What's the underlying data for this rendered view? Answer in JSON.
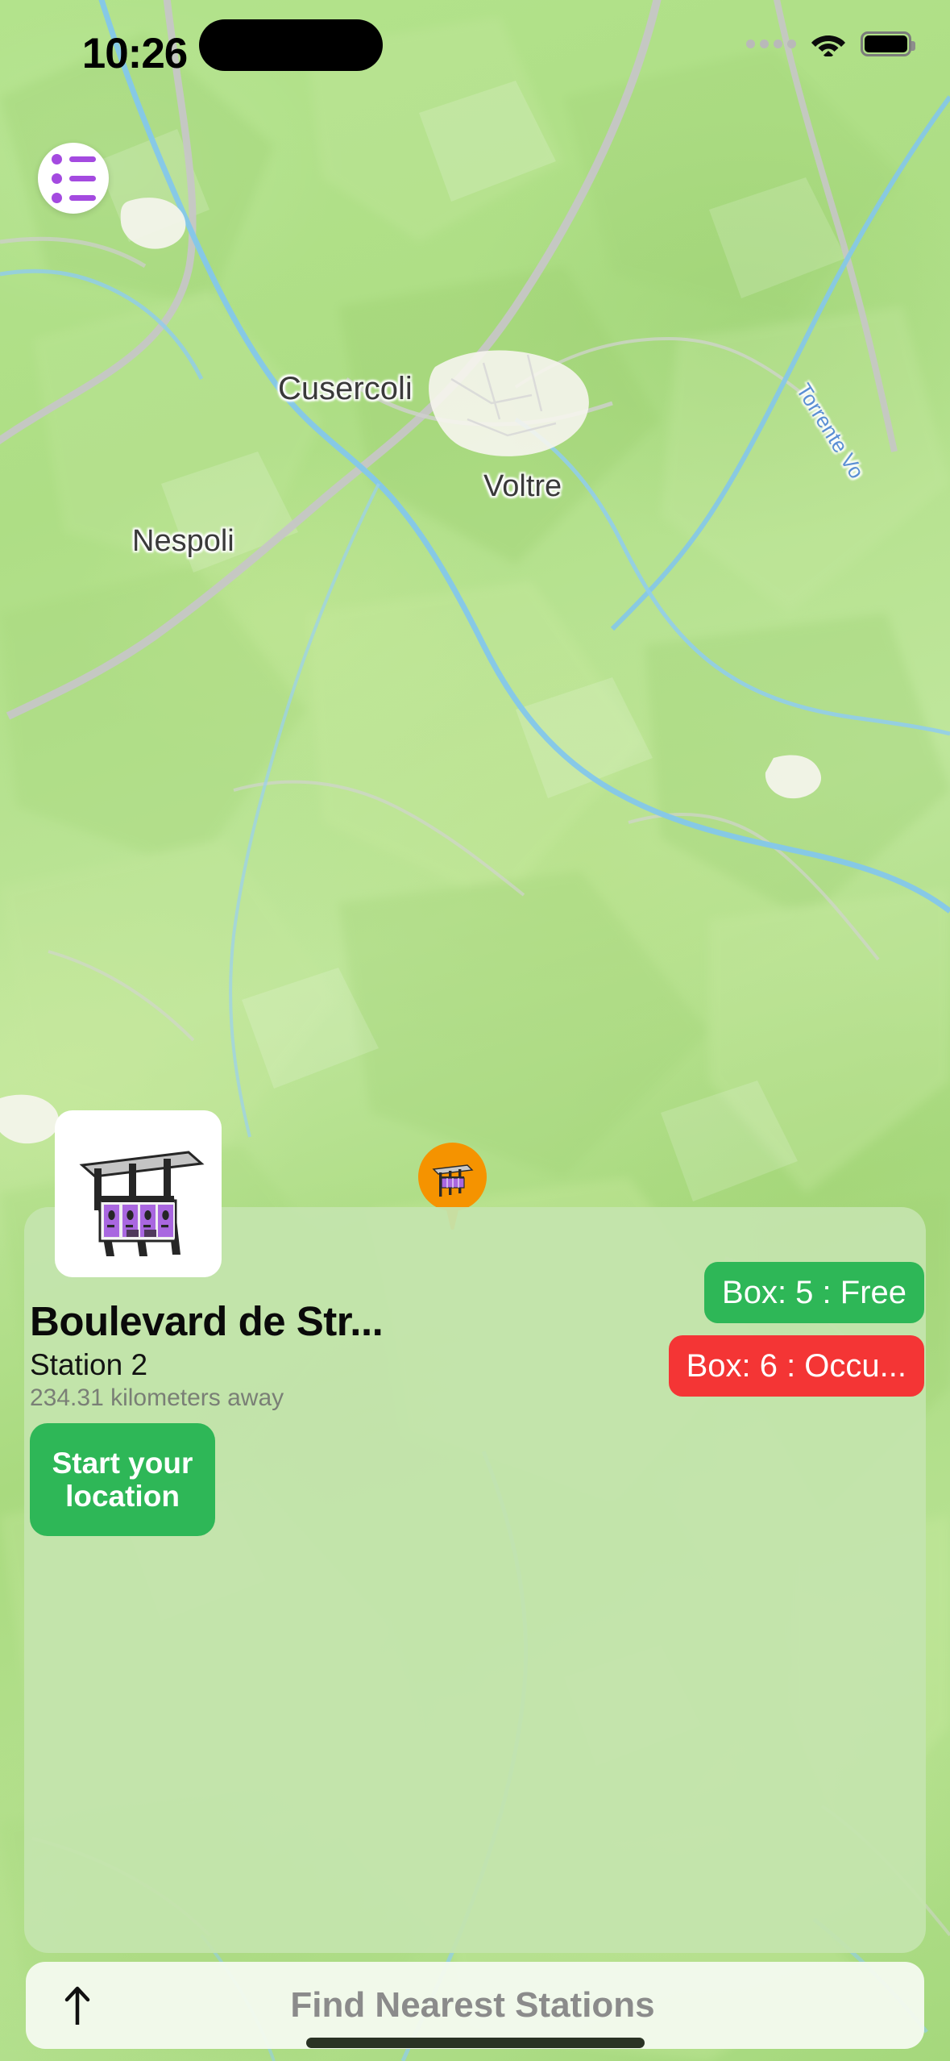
{
  "status_bar": {
    "time": "10:26",
    "wifi_icon": "wifi-icon",
    "battery_icon": "battery-full-icon",
    "cellular_icon": "signal-dots-icon"
  },
  "menu_button": {
    "icon": "list-menu-icon",
    "accent_color": "#a44ae0"
  },
  "map": {
    "labels": [
      {
        "name": "Cusercoli",
        "type": "town"
      },
      {
        "name": "Voltre",
        "type": "town"
      },
      {
        "name": "Nespoli",
        "type": "town"
      },
      {
        "name": "Torrente Vo",
        "type": "river"
      }
    ],
    "pin": {
      "icon": "charging-station-pin-icon",
      "color": "#f59300"
    },
    "terrain_color": "#aede85",
    "water_color": "#84c7ea",
    "road_color": "#c9c9c9"
  },
  "station_card": {
    "thumbnail_icon": "charging-station-photo",
    "title": "Boulevard de Str...",
    "subtitle": "Station 2",
    "distance": "234.31 kilometers away",
    "start_button_label": "Start your location",
    "start_button_color": "#2eb757",
    "boxes": [
      {
        "label": "Box: 5 : Free",
        "status": "Free",
        "color": "#2eb757"
      },
      {
        "label": "Box: 6 : Occu...",
        "status": "Occupied",
        "color": "#f43535"
      }
    ],
    "background_color": "#c4e4ad"
  },
  "search_bar": {
    "icon": "arrow-up-icon",
    "label": "Find Nearest Stations",
    "background_color": "#f4faee",
    "text_color": "#8b8b8b"
  }
}
